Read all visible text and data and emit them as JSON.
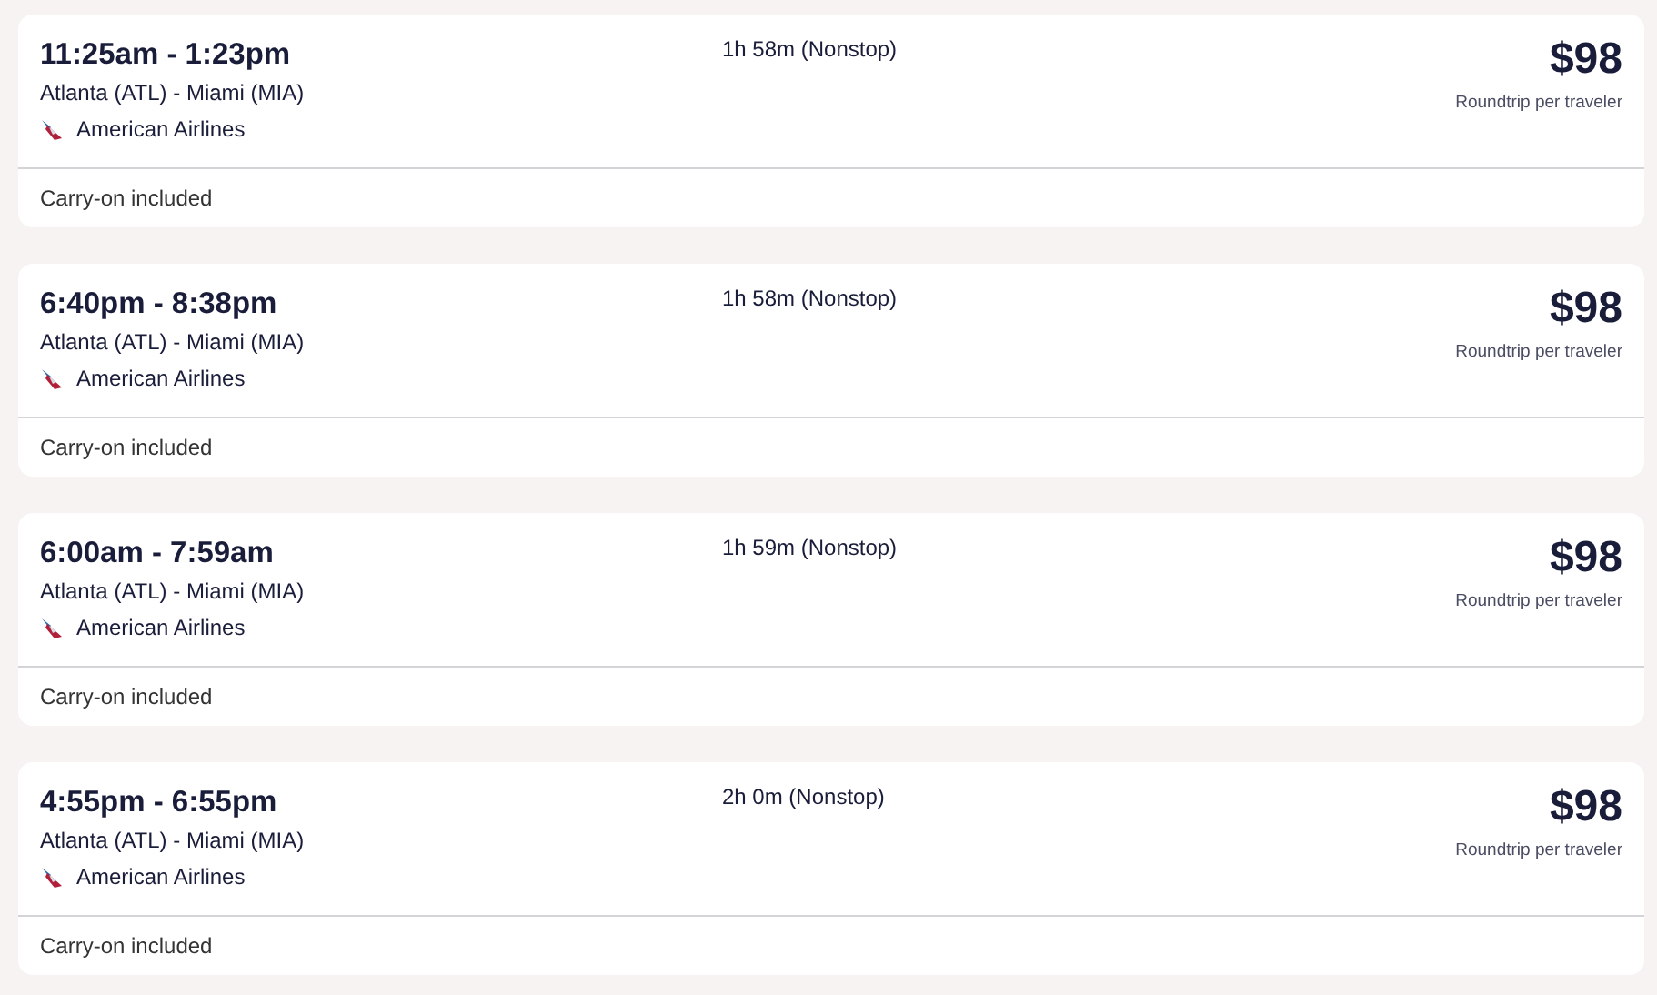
{
  "flights": [
    {
      "times": "11:25am - 1:23pm",
      "route": "Atlanta (ATL) - Miami (MIA)",
      "airline": "American Airlines",
      "duration": "1h 58m (Nonstop)",
      "price": "$98",
      "price_note": "Roundtrip per traveler",
      "baggage": "Carry-on included"
    },
    {
      "times": "6:40pm - 8:38pm",
      "route": "Atlanta (ATL) - Miami (MIA)",
      "airline": "American Airlines",
      "duration": "1h 58m (Nonstop)",
      "price": "$98",
      "price_note": "Roundtrip per traveler",
      "baggage": "Carry-on included"
    },
    {
      "times": "6:00am - 7:59am",
      "route": "Atlanta (ATL) - Miami (MIA)",
      "airline": "American Airlines",
      "duration": "1h 59m (Nonstop)",
      "price": "$98",
      "price_note": "Roundtrip per traveler",
      "baggage": "Carry-on included"
    },
    {
      "times": "4:55pm - 6:55pm",
      "route": "Atlanta (ATL) - Miami (MIA)",
      "airline": "American Airlines",
      "duration": "2h 0m (Nonstop)",
      "price": "$98",
      "price_note": "Roundtrip per traveler",
      "baggage": "Carry-on included"
    }
  ]
}
